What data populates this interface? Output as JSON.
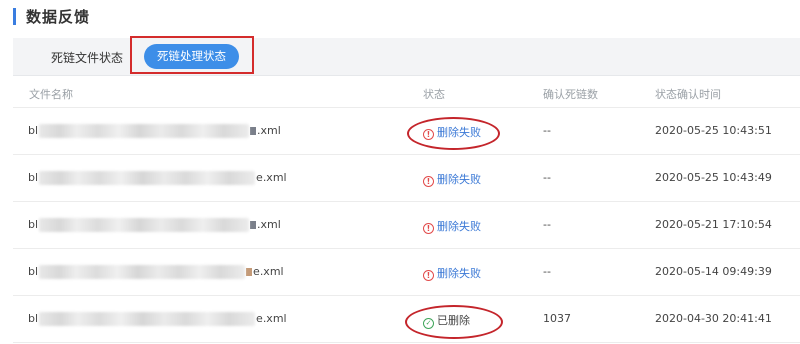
{
  "page": {
    "title": "数据反馈"
  },
  "tabs": [
    {
      "label": "死链文件状态",
      "active": false
    },
    {
      "label": "死链处理状态",
      "active": true
    }
  ],
  "table": {
    "headers": {
      "file": "文件名称",
      "status": "状态",
      "count": "确认死链数",
      "time": "状态确认时间"
    },
    "rows": [
      {
        "file_prefix": "bl",
        "file_suffix": ".xml",
        "status": "删除失败",
        "status_type": "fail",
        "count": "--",
        "time": "2020-05-25 10:43:51"
      },
      {
        "file_prefix": "bl",
        "file_suffix": "e.xml",
        "status": "删除失败",
        "status_type": "fail",
        "count": "--",
        "time": "2020-05-25 10:43:49"
      },
      {
        "file_prefix": "bl",
        "file_suffix": ".xml",
        "status": "删除失败",
        "status_type": "fail",
        "count": "--",
        "time": "2020-05-21 17:10:54"
      },
      {
        "file_prefix": "bl",
        "file_suffix": "e.xml",
        "status": "删除失败",
        "status_type": "fail",
        "count": "--",
        "time": "2020-05-14 09:49:39"
      },
      {
        "file_prefix": "bl",
        "file_suffix": "e.xml",
        "status": "已删除",
        "status_type": "ok",
        "count": "1037",
        "time": "2020-04-30 20:41:41"
      }
    ]
  },
  "colors": {
    "accent": "#3a7de0",
    "active_tab": "#3d8ee8",
    "fail_icon": "#e24b4b",
    "ok_icon": "#3fa55a",
    "annotation": "#c4252b"
  }
}
